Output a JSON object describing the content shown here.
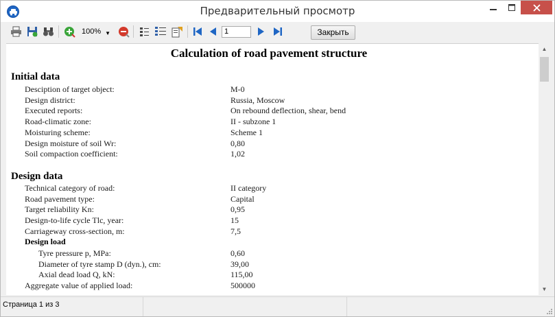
{
  "window": {
    "title": "Предварительный просмотр"
  },
  "toolbar": {
    "zoom": "100%",
    "page": "1",
    "close_label": "Закрыть"
  },
  "document": {
    "title": "Calculation of road pavement structure",
    "sections": [
      {
        "heading": "Initial data",
        "rows": [
          {
            "label": "Desciption of target object:",
            "value": "M-0"
          },
          {
            "label": "Design district:",
            "value": "Russia, Moscow"
          },
          {
            "label": "Executed reports:",
            "value": "On rebound deflection, shear, bend"
          },
          {
            "label": "Road-climatic zone:",
            "value": "II - subzone 1"
          },
          {
            "label": "Moisturing scheme:",
            "value": "Scheme 1"
          },
          {
            "label": "Design moisture of soil Wr:",
            "value": "0,80"
          },
          {
            "label": "Soil compaction coefficient:",
            "value": "1,02"
          }
        ]
      },
      {
        "heading": "Design data",
        "rows": [
          {
            "label": "Technical category of road:",
            "value": "II category"
          },
          {
            "label": "Road pavement type:",
            "value": "Capital"
          },
          {
            "label": "Target reliability Kn:",
            "value": "0,95"
          },
          {
            "label": "Design-to-life cycle Tlc, year:",
            "value": "15"
          },
          {
            "label": "Carriageway cross-section, m:",
            "value": "7,5"
          }
        ],
        "subsection": {
          "heading": "Design load",
          "rows": [
            {
              "label": "Tyre pressure p, MPa:",
              "value": "0,60"
            },
            {
              "label": "Diameter of tyre stamp D (dyn.), cm:",
              "value": "39,00"
            },
            {
              "label": "Axial dead load Q, kN:",
              "value": "115,00"
            }
          ]
        },
        "after_rows": [
          {
            "label": "Aggregate value of applied load:",
            "value": "500000"
          }
        ]
      }
    ]
  },
  "status": {
    "page_info": "Страница 1 из 3"
  },
  "colors": {
    "close_hover": "#c7504a",
    "accent": "#1f66c4"
  }
}
